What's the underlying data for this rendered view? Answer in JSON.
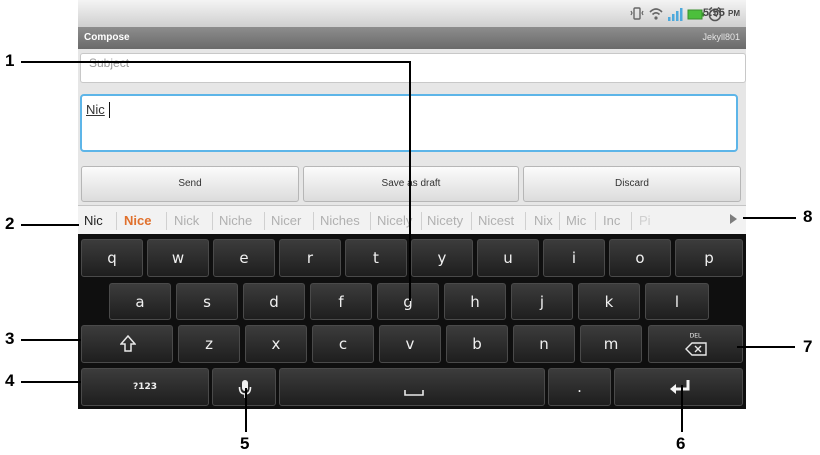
{
  "status_bar": {
    "time": "5:55",
    "meridiem": "PM",
    "icons": [
      "vibrate-icon",
      "wifi-icon",
      "signal-icon",
      "battery-icon",
      "alarm-icon"
    ]
  },
  "titlebar": {
    "title": "Compose",
    "account": "Jekyll801"
  },
  "form": {
    "subject_placeholder": "Subject",
    "body_text": "Nic",
    "send_label": "Send",
    "save_label": "Save as draft",
    "discard_label": "Discard"
  },
  "suggestions": [
    "Nic",
    "Nice",
    "Nick",
    "Niche",
    "Nicer",
    "Niches",
    "Nicely",
    "Nicety",
    "Nicest",
    "Nix",
    "Mic",
    "Inc",
    "Pi"
  ],
  "keyboard": {
    "row1": [
      "q",
      "w",
      "e",
      "r",
      "t",
      "y",
      "u",
      "i",
      "o",
      "p"
    ],
    "row2": [
      "a",
      "s",
      "d",
      "f",
      "g",
      "h",
      "j",
      "k",
      "l"
    ],
    "row3": [
      "z",
      "x",
      "c",
      "v",
      "b",
      "n",
      "m"
    ],
    "numbers_label": "?123",
    "del_label": "DEL",
    "period_label": ".",
    "shift_icon": "shift-icon",
    "mic_icon": "microphone-icon",
    "space_icon": "space-icon",
    "backspace_icon": "backspace-icon",
    "enter_icon": "enter-icon"
  },
  "callouts": [
    "1",
    "2",
    "3",
    "4",
    "5",
    "6",
    "7",
    "8"
  ],
  "colors": {
    "suggestion_highlight": "#e0702c",
    "focus_border": "#5db5e8",
    "keyboard_bg": "#0f0f0f"
  }
}
